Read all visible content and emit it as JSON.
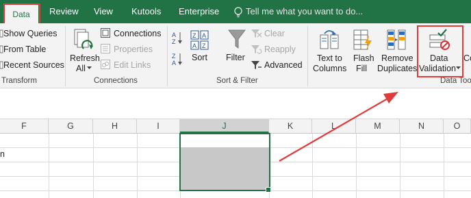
{
  "tabs": [
    {
      "label": "Data",
      "active": true
    },
    {
      "label": "Review"
    },
    {
      "label": "View"
    },
    {
      "label": "Kutools"
    },
    {
      "label": "Enterprise"
    }
  ],
  "tell_me": "Tell me what you want to do...",
  "ribbon": {
    "get_transform": {
      "show_queries": "Show Queries",
      "from_table": "From Table",
      "recent_sources": "Recent Sources",
      "group_label": "Transform"
    },
    "connections": {
      "connections": "Connections",
      "properties": "Properties",
      "edit_links": "Edit Links",
      "refresh_line1": "Refresh",
      "refresh_line2": "All",
      "group_label": "Connections"
    },
    "sort_filter": {
      "sort": "Sort",
      "filter": "Filter",
      "clear": "Clear",
      "reapply": "Reapply",
      "advanced": "Advanced",
      "group_label": "Sort & Filter"
    },
    "data_tools": {
      "text_to_columns_line1": "Text to",
      "text_to_columns_line2": "Columns",
      "flash_fill_line1": "Flash",
      "flash_fill_line2": "Fill",
      "remove_duplicates_line1": "Remove",
      "remove_duplicates_line2": "Duplicates",
      "data_validation_line1": "Data",
      "data_validation_line2": "Validation",
      "group_label": "Data Too",
      "next_button_partial": "Co"
    }
  },
  "columns": [
    "F",
    "G",
    "H",
    "I",
    "J",
    "K",
    "L",
    "M",
    "N",
    "O"
  ],
  "cell_fragment": "n",
  "colors": {
    "excel_green": "#217346",
    "highlight_red": "#e03c3c",
    "selection_fill": "#c8c8c8"
  }
}
